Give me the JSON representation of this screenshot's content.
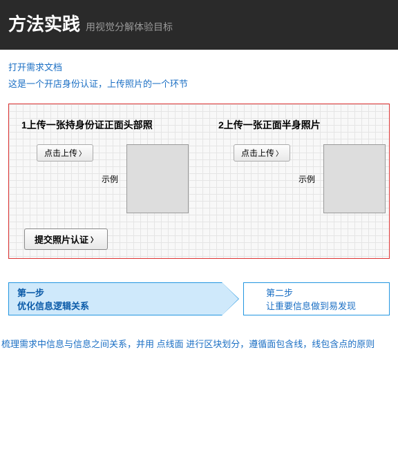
{
  "header": {
    "title": "方法实践",
    "subtitle": "用视觉分解体验目标"
  },
  "intro": {
    "link": "打开需求文档",
    "desc": "这是一个开店身份认证，上传照片的一个环节"
  },
  "uploads": [
    {
      "title": "1上传一张持身份证正面头部照",
      "btn": "点击上传",
      "example": "示例"
    },
    {
      "title": "2上传一张正面半身照片",
      "btn": "点击上传",
      "example": "示例"
    }
  ],
  "submit": "提交照片认证",
  "steps": [
    {
      "label": "第一步",
      "desc": "优化信息逻辑关系"
    },
    {
      "label": "第二步",
      "desc": "让重要信息做到易发现"
    }
  ],
  "bottom": "梳理需求中信息与信息之间关系，并用 点线面 进行区块划分，遵循面包含线，线包含点的原则"
}
